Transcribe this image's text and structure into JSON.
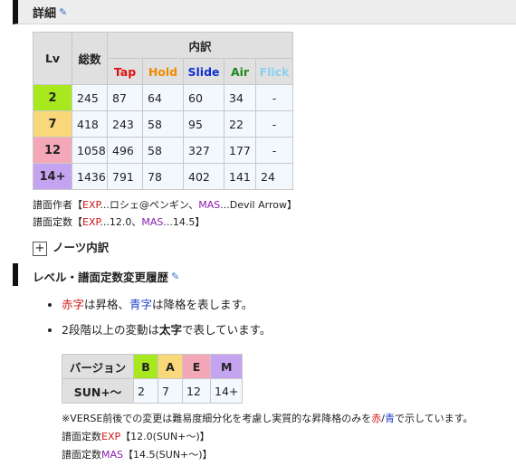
{
  "section1": {
    "title": "詳細",
    "edit_icon": "pencil-icon"
  },
  "chart_table": {
    "headers": {
      "lv": "Lv",
      "total": "総数",
      "breakdown": "内訳"
    },
    "columns": [
      {
        "label": "Tap",
        "color": "#e01010"
      },
      {
        "label": "Hold",
        "color": "#f08a00"
      },
      {
        "label": "Slide",
        "color": "#1030d0"
      },
      {
        "label": "Air",
        "color": "#1a8a1a"
      },
      {
        "label": "Flick",
        "color": "#8ad0f0"
      }
    ],
    "rows": [
      {
        "lv": "2",
        "lv_color": "#a8e81e",
        "total": "245",
        "tap": "87",
        "hold": "64",
        "slide": "60",
        "air": "34",
        "flick": "-"
      },
      {
        "lv": "7",
        "lv_color": "#f9d87a",
        "total": "418",
        "tap": "243",
        "hold": "58",
        "slide": "95",
        "air": "22",
        "flick": "-"
      },
      {
        "lv": "12",
        "lv_color": "#f4a7b6",
        "total": "1058",
        "tap": "496",
        "hold": "58",
        "slide": "327",
        "air": "177",
        "flick": "-"
      },
      {
        "lv": "14+",
        "lv_color": "#c4a3f0",
        "total": "1436",
        "tap": "791",
        "hold": "78",
        "slide": "402",
        "air": "141",
        "flick": "24"
      }
    ]
  },
  "notes": {
    "author_label": "譜面作者【",
    "author_exp_tag": "EXP",
    "author_exp_val": "...ロシェ@ペンギン、",
    "author_mas_tag": "MAS",
    "author_mas_val": "...Devil Arrow】",
    "const_label": "譜面定数【",
    "const_exp_tag": "EXP",
    "const_exp_val": "...12.0、",
    "const_mas_tag": "MAS",
    "const_mas_val": "...14.5】"
  },
  "toggle": {
    "symbol": "+",
    "label": "ノーツ内訳"
  },
  "section2": {
    "title": "レベル・譜面定数変更履歴",
    "edit_icon": "pencil-icon"
  },
  "bullets": {
    "b1_red": "赤字",
    "b1_mid": "は昇格、",
    "b1_blue": "青字",
    "b1_end": "は降格を表します。",
    "b2_start": "2段階以上の変動は",
    "b2_bold": "太字",
    "b2_end": "で表しています。"
  },
  "version_table": {
    "header_label": "バージョン",
    "cols": [
      {
        "label": "B",
        "color": "#a8e81e"
      },
      {
        "label": "A",
        "color": "#f9d87a"
      },
      {
        "label": "E",
        "color": "#f4a7b6"
      },
      {
        "label": "M",
        "color": "#c4a3f0"
      }
    ],
    "row": {
      "label": "SUN+～",
      "values": [
        "2",
        "7",
        "12",
        "14+"
      ]
    }
  },
  "footnotes": {
    "verse_start": "※VERSE前後での変更は難易度細分化を考慮し実質的な昇降格のみを",
    "verse_red": "赤",
    "verse_slash": "/",
    "verse_blue": "青",
    "verse_end": "で示しています。",
    "exp_label": "譜面定数",
    "exp_tag": "EXP",
    "exp_val": "【12.0(SUN+～)】",
    "mas_label": "譜面定数",
    "mas_tag": "MAS",
    "mas_val": "【14.5(SUN+～)】"
  }
}
